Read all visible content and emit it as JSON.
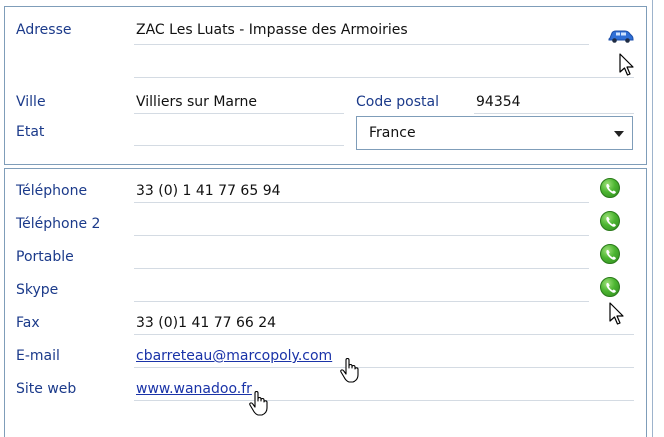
{
  "address": {
    "adresse_label": "Adresse",
    "adresse_value": "ZAC Les Luats - Impasse des Armoiries",
    "ville_label": "Ville",
    "ville_value": "Villiers sur Marne",
    "code_postal_label": "Code postal",
    "code_postal_value": "94354",
    "etat_label": "Etat",
    "etat_value": "",
    "country_selected": "France",
    "map_icon": "car-icon"
  },
  "contact": {
    "rows": [
      {
        "label": "Téléphone",
        "value": "33 (0) 1 41 77 65 94"
      },
      {
        "label": "Téléphone 2",
        "value": ""
      },
      {
        "label": "Portable",
        "value": ""
      },
      {
        "label": "Skype",
        "value": ""
      },
      {
        "label": "Fax",
        "value": "33 (0)1 41 77 66 24"
      },
      {
        "label": "E-mail",
        "value": "cbarreteau@marcopoly.com"
      },
      {
        "label": "Site web",
        "value": "www.wanadoo.fr"
      }
    ],
    "call_icon": "phone-icon"
  },
  "colors": {
    "label_blue": "#1b3a8a",
    "link_blue": "#1a33a8",
    "border": "#7f9db9",
    "call_green": "#4cb531"
  }
}
